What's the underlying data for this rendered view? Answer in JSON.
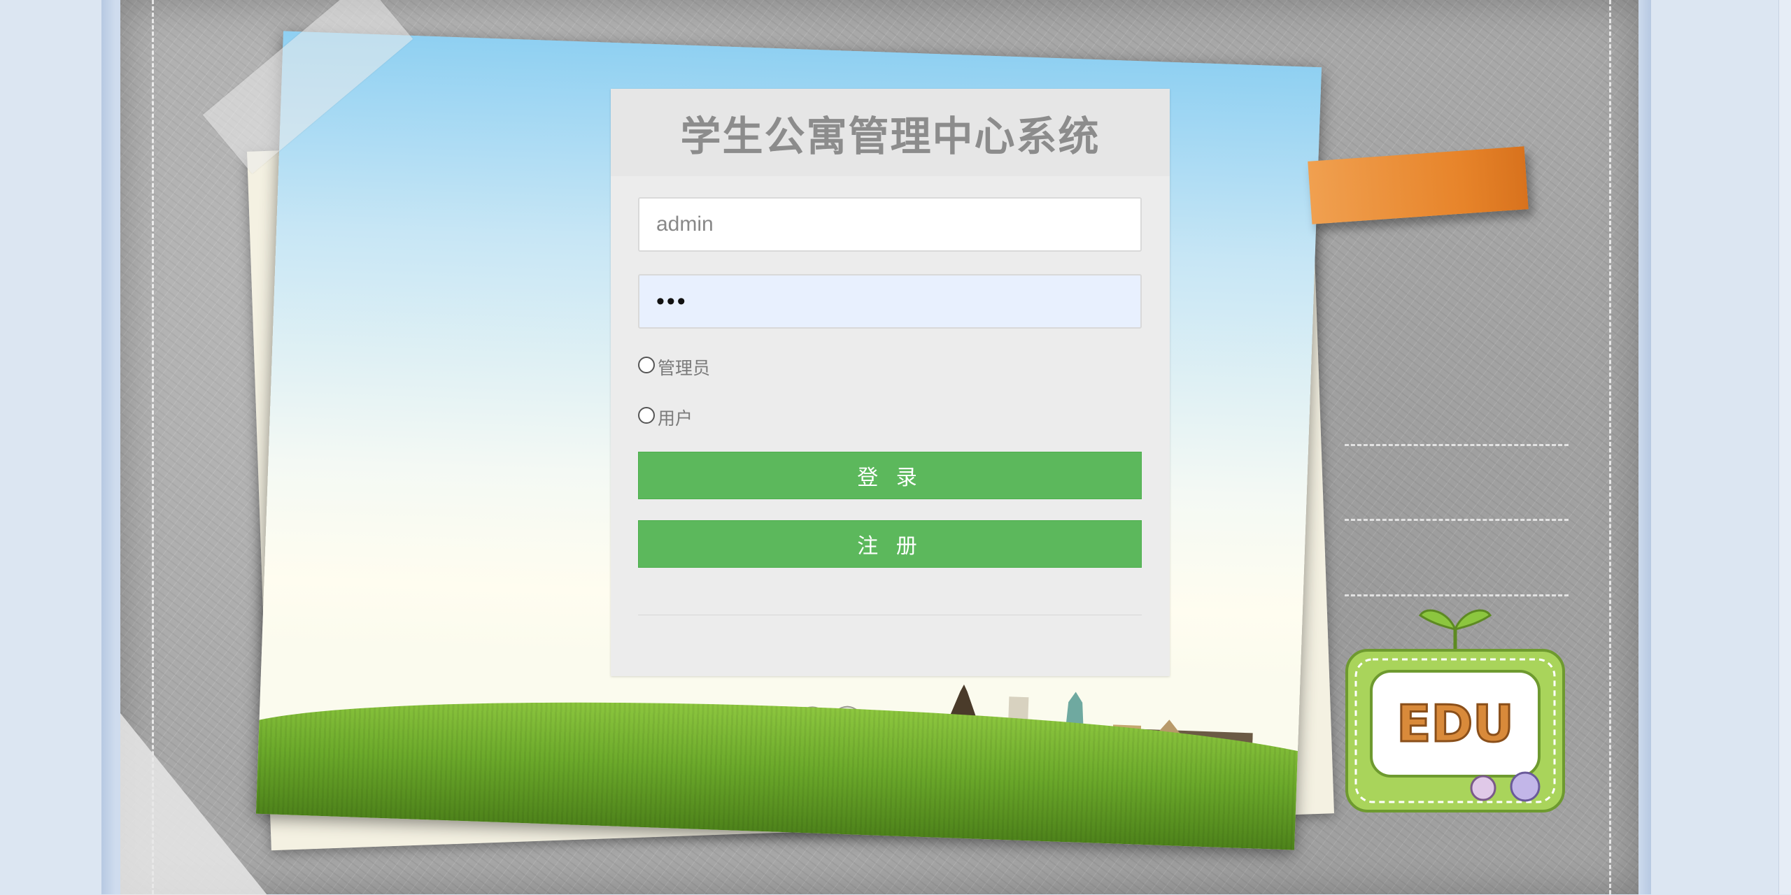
{
  "page": {
    "title": "学生公寓管理中心系统"
  },
  "login": {
    "username_value": "admin",
    "password_value": "•••",
    "roles": [
      {
        "label": "管理员",
        "selected": false
      },
      {
        "label": "用户",
        "selected": false
      }
    ],
    "login_label": "登 录",
    "register_label": "注 册"
  },
  "decor": {
    "badge_text": "EDU",
    "colors": {
      "button": "#5cb85c",
      "accent_tab": "#e7842a",
      "panel": "#ececec",
      "background": "#dce6f2"
    }
  }
}
